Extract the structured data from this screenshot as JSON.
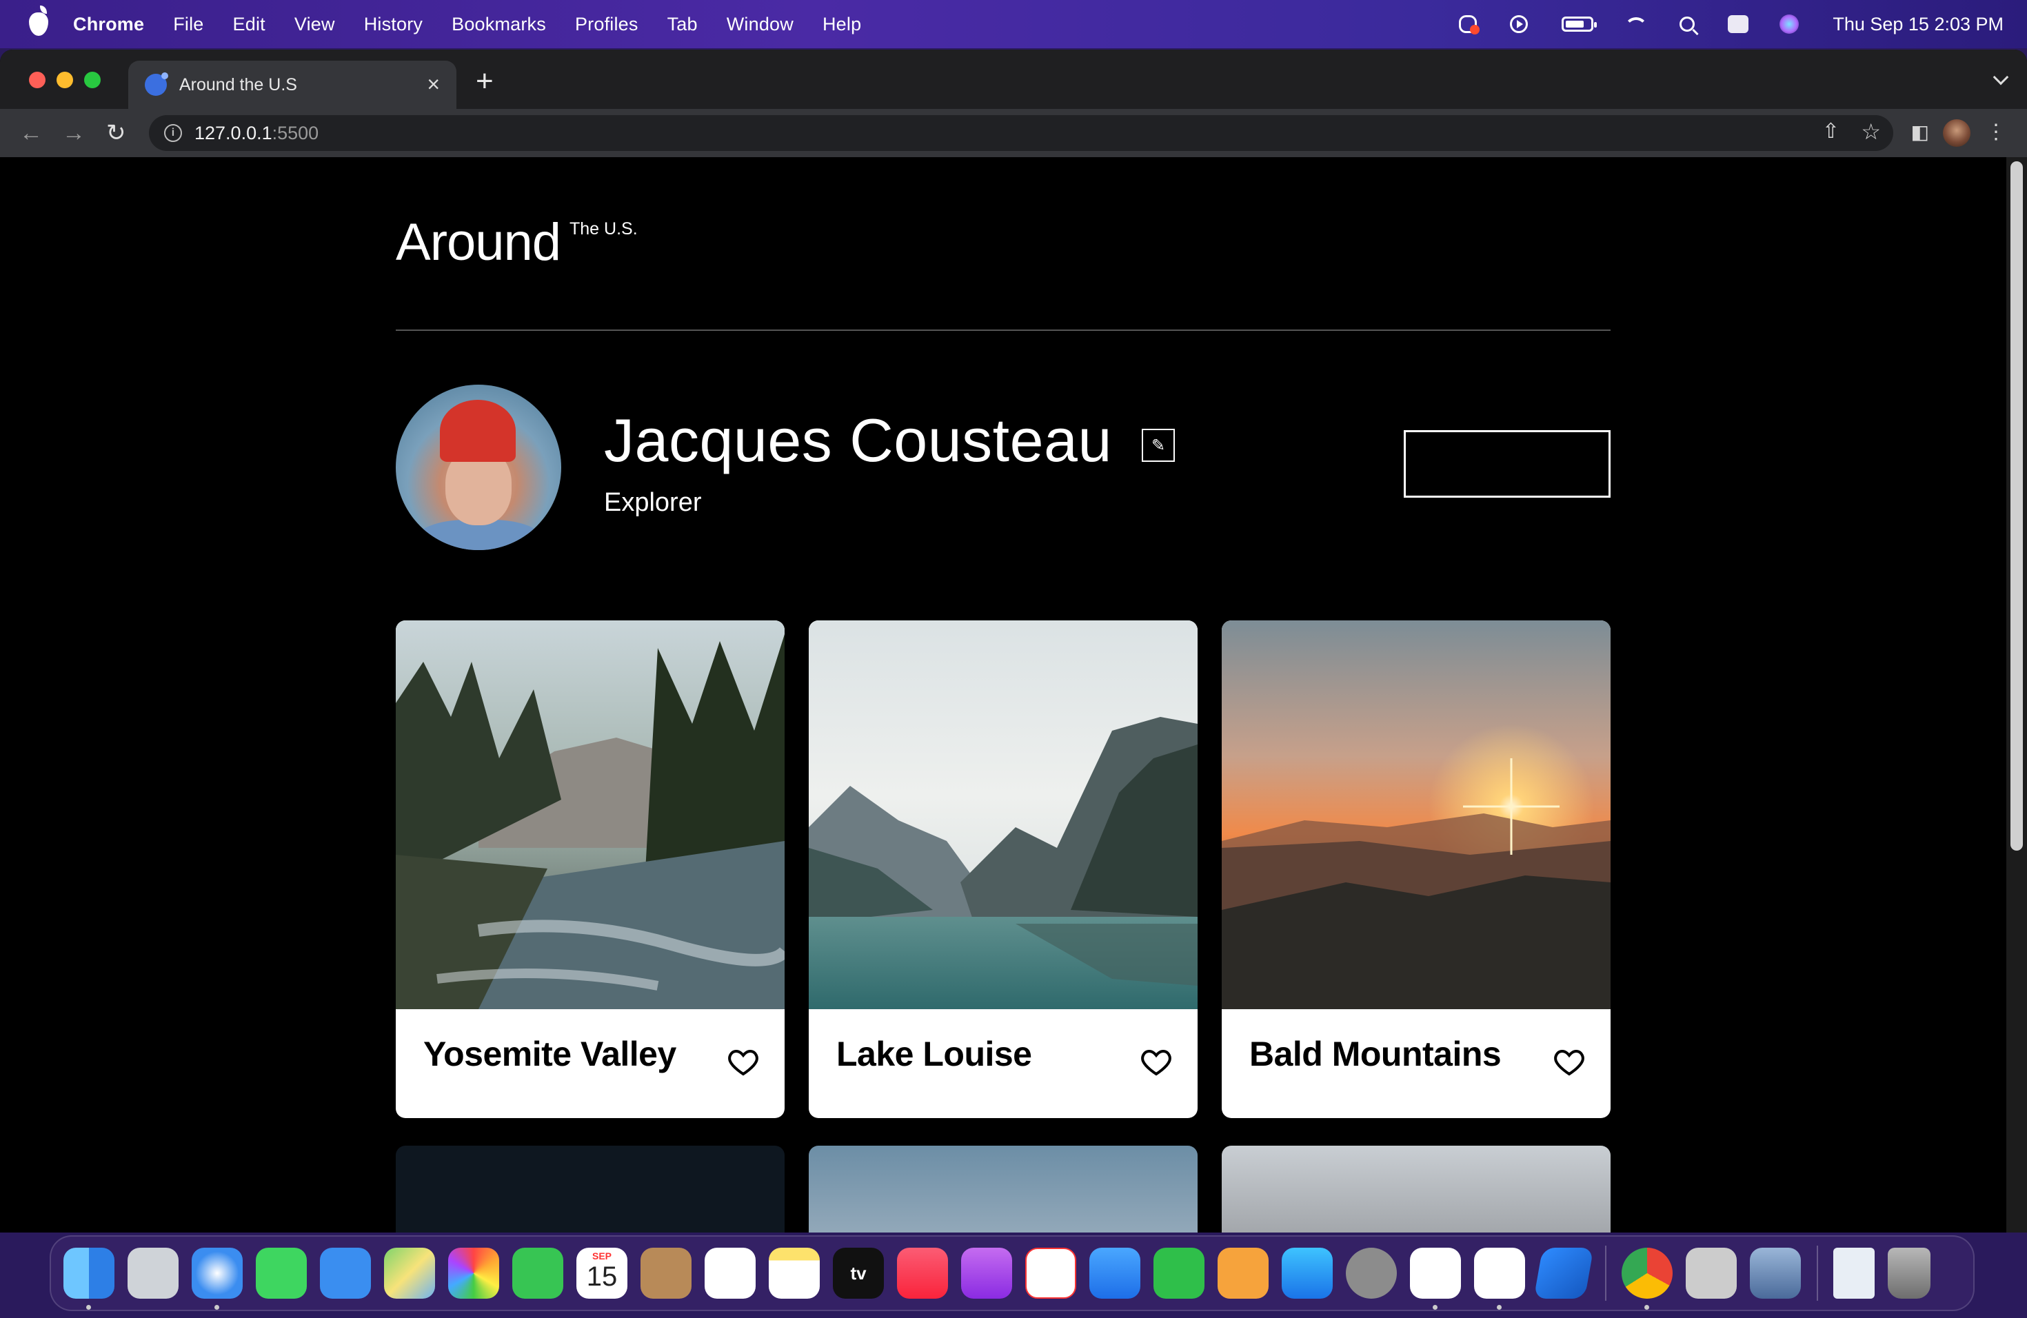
{
  "menubar": {
    "app_name": "Chrome",
    "menus": [
      "File",
      "Edit",
      "View",
      "History",
      "Bookmarks",
      "Profiles",
      "Tab",
      "Window",
      "Help"
    ],
    "clock": "Thu Sep 15  2:03 PM",
    "status_icons": [
      "creative-cloud-icon",
      "play-circle-icon",
      "battery-icon",
      "wifi-icon",
      "search-icon",
      "control-center-icon",
      "siri-icon"
    ]
  },
  "browser": {
    "tab_title": "Around the U.S",
    "url_host": "127.0.0.1",
    "url_port": ":5500",
    "new_tab": "+",
    "close_tab": "×"
  },
  "page": {
    "logo": "Around",
    "logo_sup": "The U.S.",
    "profile": {
      "name": "Jacques Cousteau",
      "role": "Explorer",
      "edit_icon": "pencil-icon"
    },
    "cards": [
      {
        "title": "Yosemite Valley"
      },
      {
        "title": "Lake Louise"
      },
      {
        "title": "Bald Mountains"
      }
    ]
  },
  "dock": {
    "apps": [
      "finder",
      "launchpad",
      "safari",
      "messages",
      "mail",
      "maps",
      "photos",
      "facetime",
      "calendar",
      "contacts",
      "reminders",
      "notes",
      "apple-tv",
      "music",
      "podcasts",
      "news",
      "keynote",
      "numbers",
      "pages",
      "app-store",
      "system-preferences",
      "slack",
      "vscode",
      "blue-app",
      "chrome",
      "font-book",
      "preview",
      "eml-document",
      "trash"
    ],
    "calendar_month": "SEP",
    "calendar_day": "15",
    "tv_label": "tv"
  },
  "colors": {
    "page_bg": "#000000",
    "card_bg": "#ffffff",
    "menubar": "#4a2aa5"
  }
}
